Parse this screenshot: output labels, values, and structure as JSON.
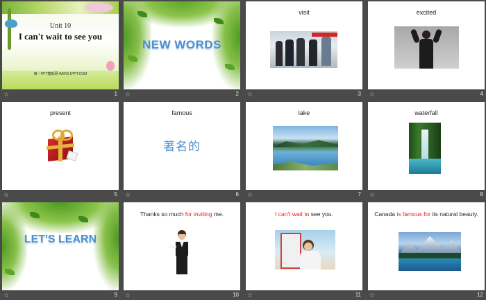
{
  "slides": [
    {
      "num": "1",
      "unit": "Unit 10",
      "title": "I can't wait to see you",
      "site": "第一PPT模板网-WWW.1PPT.COM"
    },
    {
      "num": "2",
      "heading": "NEW WORDS"
    },
    {
      "num": "3",
      "word": "visit"
    },
    {
      "num": "4",
      "word": "excited"
    },
    {
      "num": "5",
      "word": "present"
    },
    {
      "num": "6",
      "word": "famous",
      "chinese": "著名的"
    },
    {
      "num": "7",
      "word": "lake"
    },
    {
      "num": "8",
      "word": "waterfall"
    },
    {
      "num": "9",
      "heading": "LET'S LEARN"
    },
    {
      "num": "10",
      "s_pre": "Thanks so much ",
      "s_red": "for inviting",
      "s_post": " me."
    },
    {
      "num": "11",
      "s_pre": "",
      "s_red": "I can't wait to",
      "s_post": " see you."
    },
    {
      "num": "12",
      "s_pre": "Canada ",
      "s_red": "is famous for",
      "s_post": " its natural beauty."
    }
  ],
  "star_icon": "☆",
  "colors": {
    "red_text": "#e0201a",
    "heading_blue": "#4a8fd0",
    "background": "#4a4a4a"
  }
}
